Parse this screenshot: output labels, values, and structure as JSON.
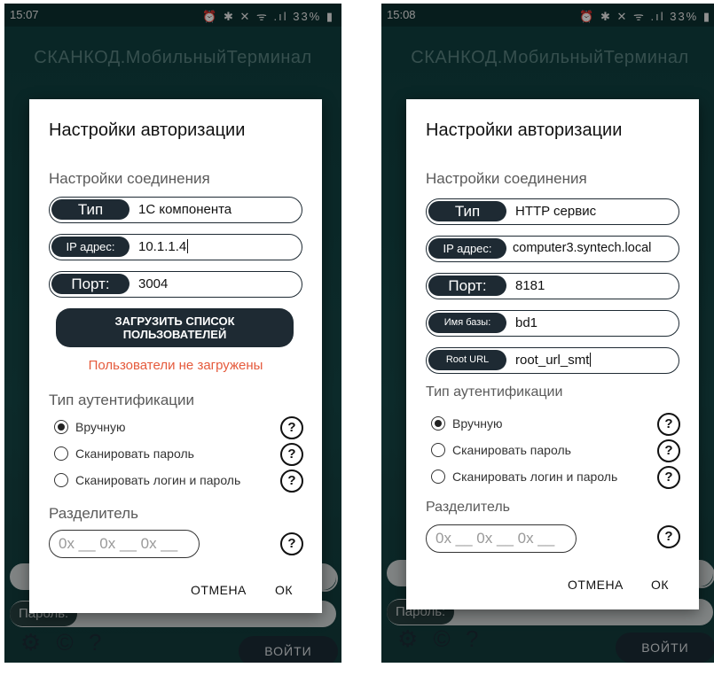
{
  "left": {
    "status": {
      "time": "15:07",
      "icons": "⏰ ✱ ✕ ᯤ .ıl 33% ▮"
    },
    "app_title": "СКАНКОД.МобильныйТерминал",
    "dialog": {
      "title": "Настройки авторизации",
      "connection_section": "Настройки соединения",
      "type_label": "Тип",
      "type_value": "1С компонента",
      "ip_label": "IP адрес:",
      "ip_value": "10.1.1.4",
      "port_label": "Порт:",
      "port_value": "3004",
      "load_button_line1": "ЗАГРУЗИТЬ СПИСОК",
      "load_button_line2": "ПОЛЬЗОВАТЕЛЕЙ",
      "error_text": "Пользователи не загружены",
      "auth_section": "Тип аутентификации",
      "auth_options": [
        "Вручную",
        "Сканировать пароль",
        "Сканировать логин и пароль"
      ],
      "auth_selected": 0,
      "separator_section": "Разделитель",
      "separator_placeholder": "0x __ 0x __ 0x __",
      "help_glyph": "?",
      "cancel": "ОТМЕНА",
      "ok": "ОК"
    },
    "background": {
      "password_label": "Пароль:",
      "login_button": "ВОЙТИ"
    }
  },
  "right": {
    "status": {
      "time": "15:08",
      "icons": "⏰ ✱ ✕ ᯤ .ıl 33% ▮"
    },
    "app_title": "СКАНКОД.МобильныйТерминал",
    "dialog": {
      "title": "Настройки авторизации",
      "connection_section": "Настройки соединения",
      "type_label": "Тип",
      "type_value": "HTTP сервис",
      "ip_label": "IP адрес:",
      "ip_value": "computer3.syntech.local",
      "port_label": "Порт:",
      "port_value": "8181",
      "dbname_label": "Имя базы:",
      "dbname_value": "bd1",
      "rooturl_label": "Root URL",
      "rooturl_value": "root_url_smt",
      "auth_section": "Тип аутентификации",
      "auth_options": [
        "Вручную",
        "Сканировать пароль",
        "Сканировать логин и пароль"
      ],
      "auth_selected": 0,
      "separator_section": "Разделитель",
      "separator_placeholder": "0x __ 0x __ 0x __",
      "help_glyph": "?",
      "cancel": "ОТМЕНА",
      "ok": "ОК"
    },
    "background": {
      "password_label": "Пароль:",
      "login_button": "ВОЙТИ"
    }
  },
  "icons": {
    "settings": "gear-icon",
    "copyright": "copyright-icon",
    "help": "help-icon",
    "menu": "menu-icon"
  },
  "colors": {
    "dark": "#1e2a33",
    "error": "#e55a3c",
    "app_bg": "#164646"
  }
}
